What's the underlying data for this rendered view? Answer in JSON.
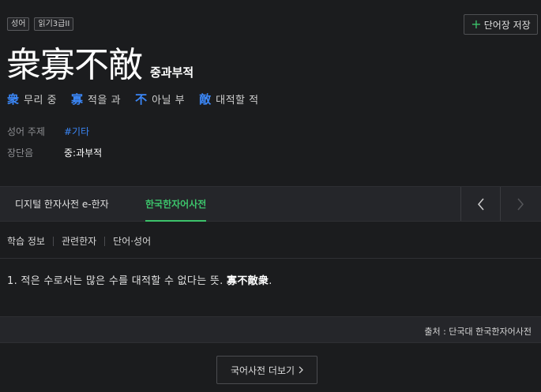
{
  "tags": [
    "성어",
    "읽기3급II"
  ],
  "save_label": "단어장 저장",
  "title": "衆寡不敵",
  "reading": "중과부적",
  "chars": [
    {
      "hanja": "衆",
      "meaning": "무리 중"
    },
    {
      "hanja": "寡",
      "meaning": "적을 과"
    },
    {
      "hanja": "不",
      "meaning": "아닐 부"
    },
    {
      "hanja": "敵",
      "meaning": "대적할 적"
    }
  ],
  "info": {
    "topic_label": "성어 주제",
    "topic_value": "#기타",
    "length_label": "장단음",
    "length_value": "중:과부적"
  },
  "tabs": [
    "디지털 한자사전 e-한자",
    "한국한자어사전"
  ],
  "subtabs": [
    "학습 정보",
    "관련한자",
    "단어·성어"
  ],
  "definition": {
    "text": "1.  적은 수로서는 많은 수를 대적할 수 없다는 뜻.",
    "example": "寡不敵衆",
    "suffix": "."
  },
  "source": "출처 : 단국대 한국한자어사전",
  "more_label": "국어사전 더보기",
  "colors": {
    "accent_green": "#3cc36b",
    "accent_blue": "#3b86f5",
    "background": "#1b1c1e"
  },
  "icons": {
    "save": "plus-icon",
    "prev": "chevron-left-icon",
    "next": "chevron-right-icon",
    "more": "chevron-right-icon"
  }
}
